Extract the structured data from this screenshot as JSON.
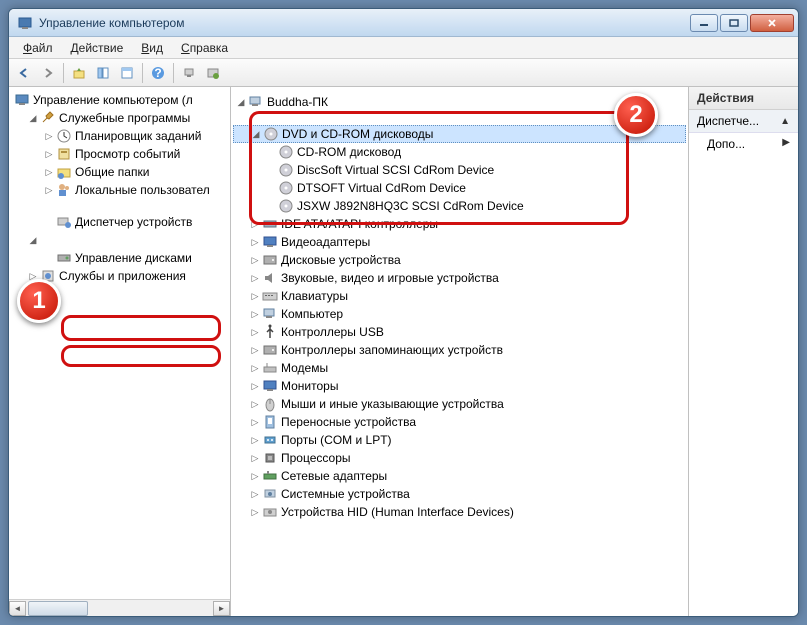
{
  "window": {
    "title": "Управление компьютером"
  },
  "menubar": {
    "file": "Файл",
    "action": "Действие",
    "view": "Вид",
    "help": "Справка"
  },
  "left_tree": {
    "root": "Управление компьютером (л",
    "system_tools": "Служебные программы",
    "task_scheduler": "Планировщик заданий",
    "event_viewer": "Просмотр событий",
    "shared_folders": "Общие папки",
    "local_users": "Локальные пользовател",
    "performance": "",
    "device_manager": "Диспетчер устройств",
    "storage": "",
    "disk_mgmt": "Управление дисками",
    "services": "Службы и приложения"
  },
  "mid_tree": {
    "root": "Buddha-ПК",
    "dvd_group": "DVD и CD-ROM дисководы",
    "dvd_items": [
      "CD-ROM дисковод",
      "DiscSoft Virtual SCSI CdRom Device",
      "DTSOFT Virtual CdRom Device",
      "JSXW J892N8HQ3C SCSI CdRom Device"
    ],
    "cats": [
      "IDE ATA/ATAPI контроллеры",
      "Видеоадаптеры",
      "Дисковые устройства",
      "Звуковые, видео и игровые устройства",
      "Клавиатуры",
      "Компьютер",
      "Контроллеры USB",
      "Контроллеры запоминающих устройств",
      "Модемы",
      "Мониторы",
      "Мыши и иные указывающие устройства",
      "Переносные устройства",
      "Порты (COM и LPT)",
      "Процессоры",
      "Сетевые адаптеры",
      "Системные устройства",
      "Устройства HID (Human Interface Devices)"
    ]
  },
  "actions": {
    "header": "Действия",
    "row1": "Диспетче...",
    "row2": "Допо..."
  },
  "badges": {
    "b1": "1",
    "b2": "2"
  }
}
